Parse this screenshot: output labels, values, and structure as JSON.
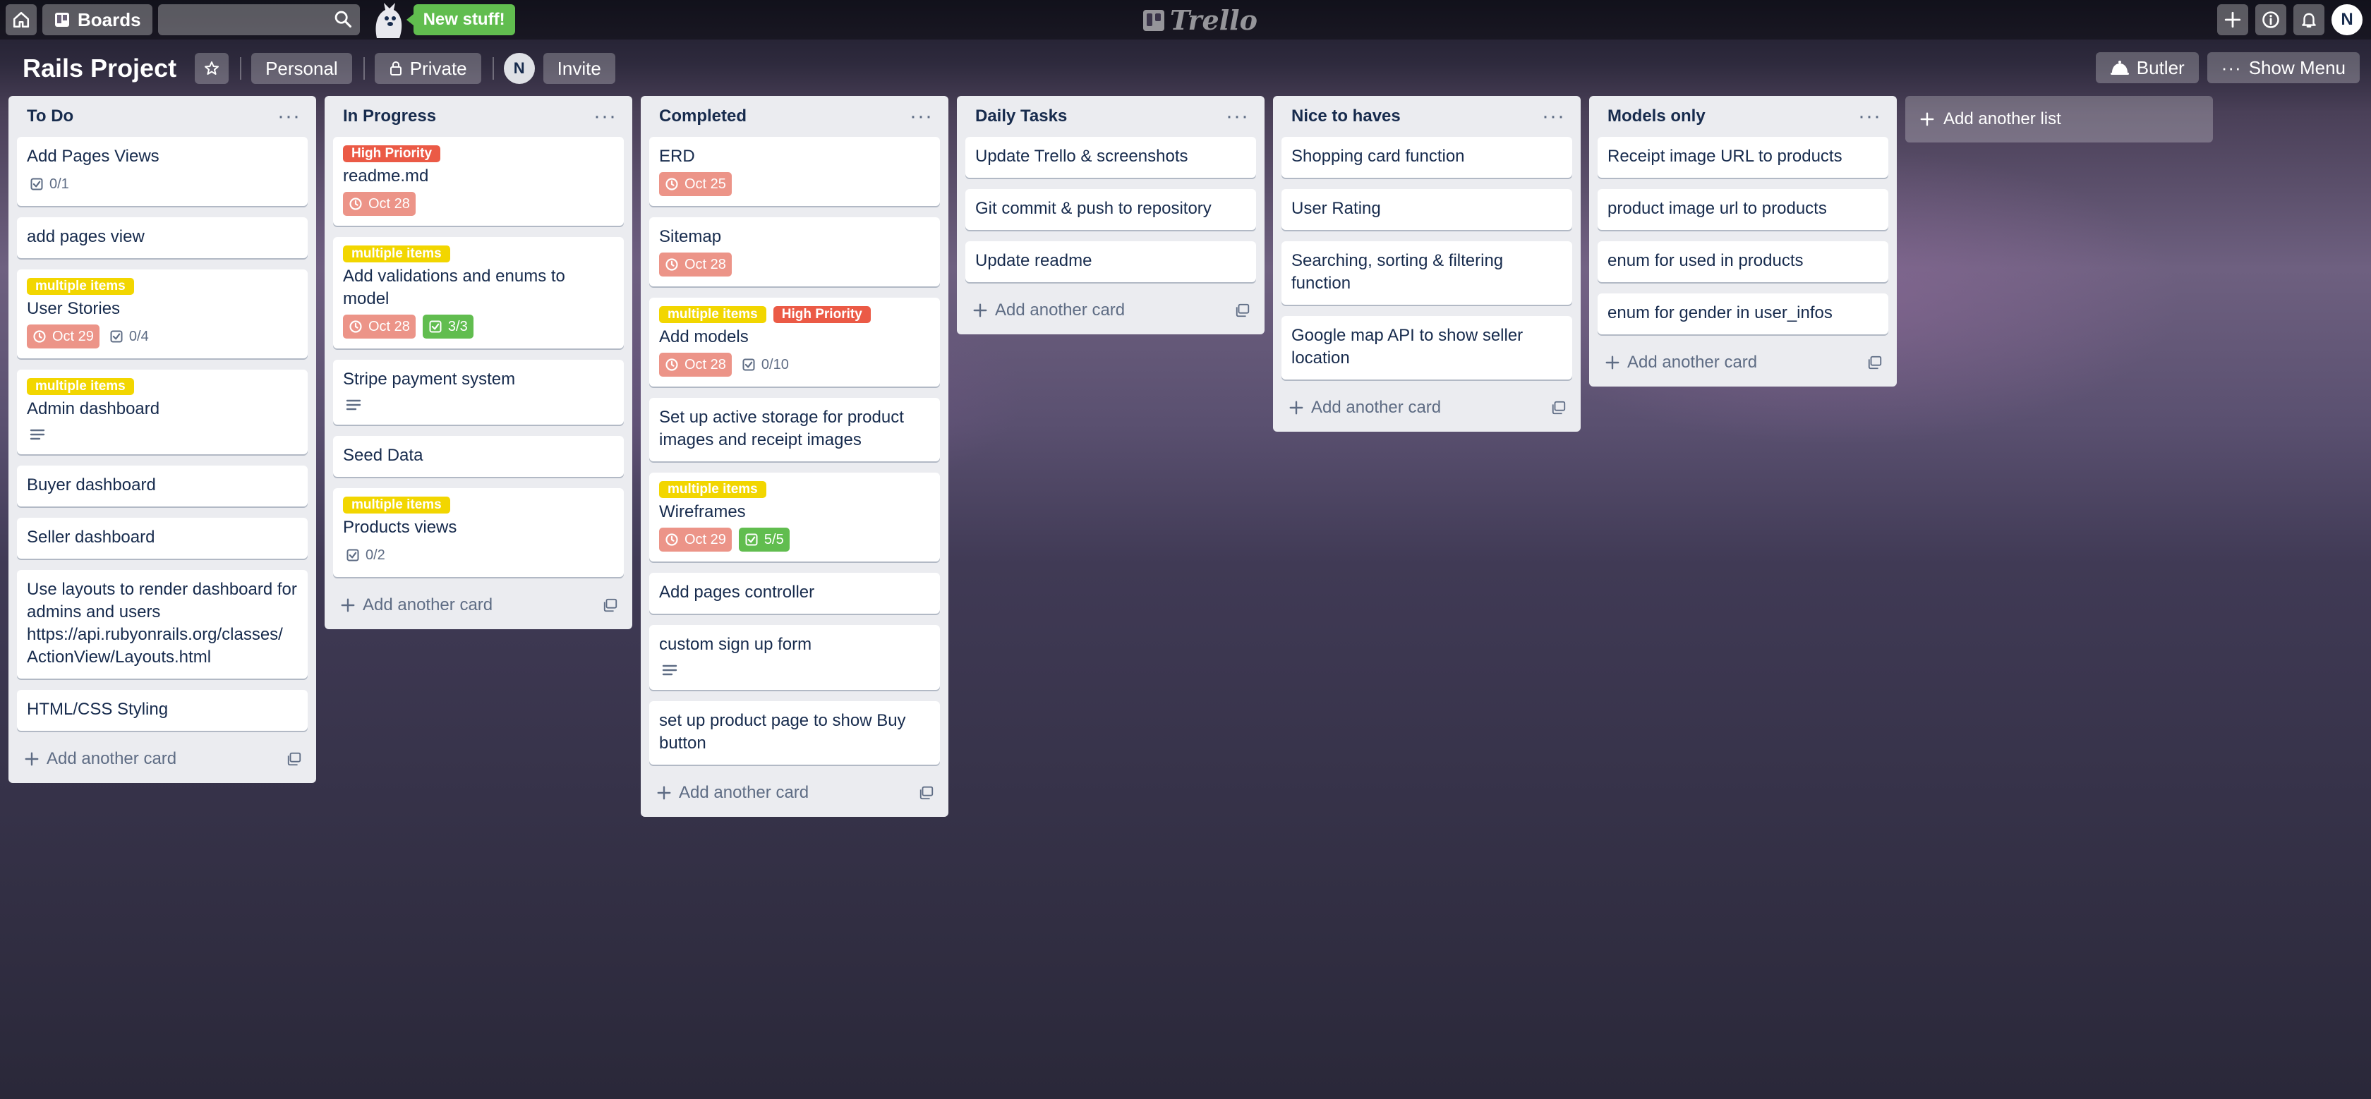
{
  "header": {
    "boards_label": "Boards",
    "new_stuff_label": "New stuff!",
    "logo_text": "Trello",
    "user_initial": "N"
  },
  "board": {
    "title": "Rails Project",
    "team_label": "Personal",
    "visibility_label": "Private",
    "member_initial": "N",
    "invite_label": "Invite",
    "butler_label": "Butler",
    "show_menu_label": "Show Menu",
    "add_list_label": "Add another list",
    "add_card_label": "Add another card"
  },
  "label_colors": {
    "yellow": "#f2d600",
    "red": "#eb5a46"
  },
  "lists": [
    {
      "title": "To Do",
      "cards": [
        {
          "title": "Add Pages Views",
          "checklist": "0/1"
        },
        {
          "title": "add pages view"
        },
        {
          "title": "User Stories",
          "labels": [
            {
              "text": "multiple items",
              "color": "yellow"
            }
          ],
          "due": "Oct 29",
          "checklist": "0/4"
        },
        {
          "title": "Admin dashboard",
          "labels": [
            {
              "text": "multiple items",
              "color": "yellow"
            }
          ],
          "description": true
        },
        {
          "title": "Buyer dashboard"
        },
        {
          "title": "Seller dashboard"
        },
        {
          "title": "Use layouts to render dashboard for admins and users https://api.rubyonrails.org/classes/ ActionView/Layouts.html"
        },
        {
          "title": "HTML/CSS Styling"
        }
      ]
    },
    {
      "title": "In Progress",
      "cards": [
        {
          "title": "readme.md",
          "labels": [
            {
              "text": "High Priority",
              "color": "red"
            }
          ],
          "due": "Oct 28"
        },
        {
          "title": "Add validations and enums to model",
          "labels": [
            {
              "text": "multiple items",
              "color": "yellow"
            }
          ],
          "due": "Oct 28",
          "checklist_done": "3/3"
        },
        {
          "title": "Stripe payment system",
          "description": true
        },
        {
          "title": "Seed Data"
        },
        {
          "title": "Products views",
          "labels": [
            {
              "text": "multiple items",
              "color": "yellow"
            }
          ],
          "checklist": "0/2"
        }
      ]
    },
    {
      "title": "Completed",
      "cards": [
        {
          "title": "ERD",
          "due": "Oct 25"
        },
        {
          "title": "Sitemap",
          "due": "Oct 28"
        },
        {
          "title": "Add models",
          "labels": [
            {
              "text": "multiple items",
              "color": "yellow"
            },
            {
              "text": "High Priority",
              "color": "red"
            }
          ],
          "due": "Oct 28",
          "checklist": "0/10"
        },
        {
          "title": "Set up active storage for product images and receipt images"
        },
        {
          "title": "Wireframes",
          "labels": [
            {
              "text": "multiple items",
              "color": "yellow"
            }
          ],
          "due": "Oct 29",
          "checklist_done": "5/5"
        },
        {
          "title": "Add pages controller"
        },
        {
          "title": "custom sign up form",
          "description": true
        },
        {
          "title": "set up product page to show Buy button"
        }
      ]
    },
    {
      "title": "Daily Tasks",
      "cards": [
        {
          "title": "Update Trello & screenshots"
        },
        {
          "title": "Git commit & push to repository"
        },
        {
          "title": "Update readme"
        }
      ]
    },
    {
      "title": "Nice to haves",
      "cards": [
        {
          "title": "Shopping card function"
        },
        {
          "title": "User Rating"
        },
        {
          "title": "Searching, sorting & filtering function"
        },
        {
          "title": "Google map API to show seller location"
        }
      ]
    },
    {
      "title": "Models only",
      "cards": [
        {
          "title": "Receipt image URL to products"
        },
        {
          "title": "product image url to products"
        },
        {
          "title": "enum for used in products"
        },
        {
          "title": "enum for gender in user_infos"
        }
      ]
    }
  ]
}
